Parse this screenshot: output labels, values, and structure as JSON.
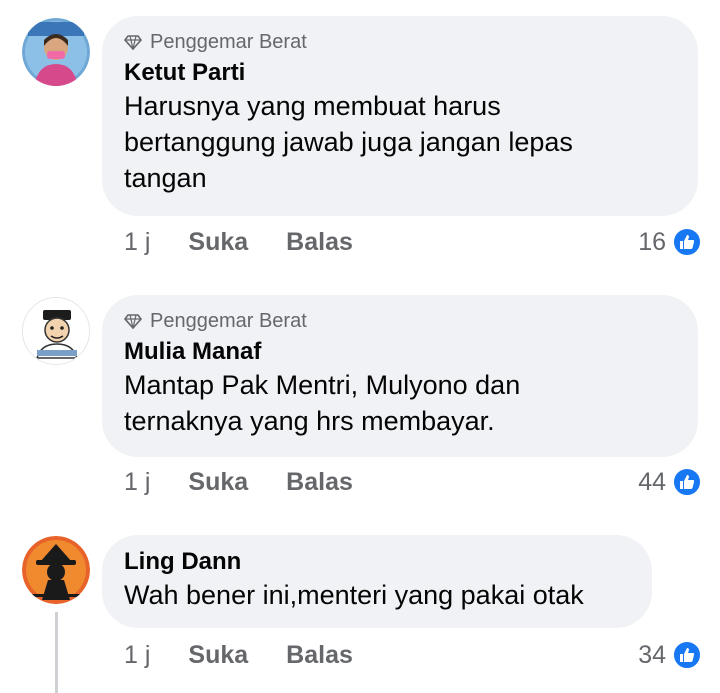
{
  "comments": [
    {
      "badge": "Penggemar Berat",
      "author": "Ketut Parti",
      "lines": [
        "Harusnya yang membuat harus",
        "bertanggung jawab juga jangan lepas",
        "tangan"
      ],
      "time": "1 j",
      "like_label": "Suka",
      "reply_label": "Balas",
      "reactions": "16"
    },
    {
      "badge": "Penggemar Berat",
      "author": "Mulia Manaf",
      "lines": [
        "Mantap Pak Mentri, Mulyono dan",
        "ternaknya yang hrs membayar."
      ],
      "time": "1 j",
      "like_label": "Suka",
      "reply_label": "Balas",
      "reactions": "44"
    },
    {
      "author": "Ling Dann",
      "lines": [
        "Wah bener ini,menteri yang pakai otak"
      ],
      "time": "1 j",
      "like_label": "Suka",
      "reply_label": "Balas",
      "reactions": "34"
    }
  ],
  "colors": {
    "bubble": "#f0f2f5",
    "secondary_text": "#65676b",
    "like_blue": "#1877f2"
  },
  "icons": [
    "diamond-icon",
    "like-thumb-icon"
  ]
}
